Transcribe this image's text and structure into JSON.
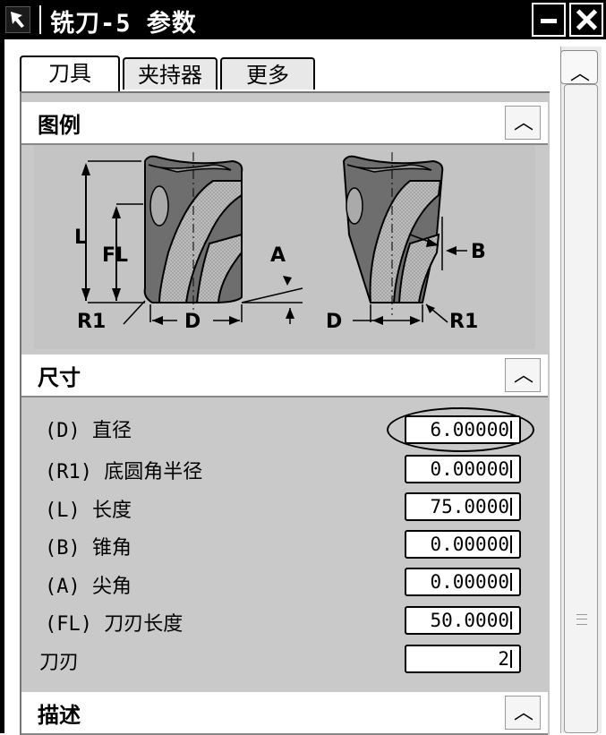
{
  "window": {
    "title": "铣刀-5 参数"
  },
  "tabs": [
    {
      "label": "刀具"
    },
    {
      "label": "夹持器"
    },
    {
      "label": "更多"
    }
  ],
  "sections": {
    "legend": {
      "title": "图例"
    },
    "dimensions": {
      "title": "尺寸"
    },
    "description": {
      "title": "描述"
    }
  },
  "illustration": {
    "labels": {
      "L": "L",
      "FL": "FL",
      "A": "A",
      "R1_left": "R1",
      "D_left": "D",
      "B": "B",
      "D_right": "D",
      "R1_right": "R1"
    }
  },
  "params": [
    {
      "label": "(D) 直径",
      "value": "6.00000"
    },
    {
      "label": "(R1) 底圆角半径",
      "value": "0.00000"
    },
    {
      "label": "(L) 长度",
      "value": "75.0000"
    },
    {
      "label": "(B) 锥角",
      "value": "0.00000"
    },
    {
      "label": "(A) 尖角",
      "value": "0.00000"
    },
    {
      "label": "(FL) 刀刃长度",
      "value": "50.0000"
    },
    {
      "label": "刀刃",
      "value": "2"
    }
  ],
  "icons": {
    "pin": "pin-icon",
    "minimize": "minimize-icon",
    "close": "close-icon",
    "collapse": "chevron-up-icon",
    "scroll_up": "scroll-up-icon"
  }
}
